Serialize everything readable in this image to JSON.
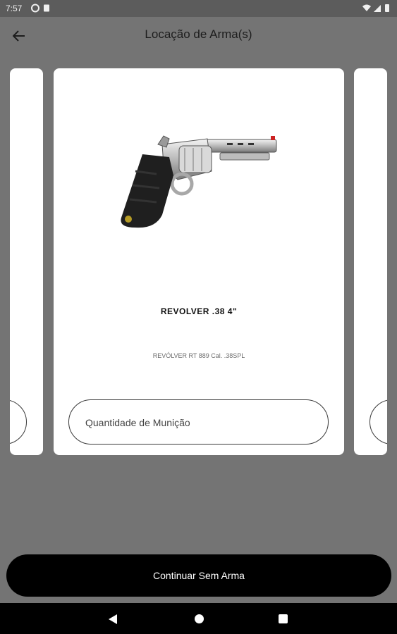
{
  "status_bar": {
    "time": "7:57",
    "left_icons": [
      "ring-icon",
      "sim-card-icon"
    ],
    "right_icons": [
      "wifi-icon",
      "signal-icon",
      "battery-icon"
    ]
  },
  "app_bar": {
    "title": "Locação de Arma(s)",
    "back_icon": "arrow-left-icon"
  },
  "carousel": {
    "current_card": {
      "name": "REVOLVER .38 4\"",
      "description": "REVÓLVER RT 889 Cal. .38SPL",
      "ammo_placeholder": "Quantidade de Munição",
      "image_icon": "revolver-image"
    }
  },
  "footer": {
    "continue_label": "Continuar Sem Arma"
  },
  "nav_bar": {
    "icons": [
      "nav-back-icon",
      "nav-home-icon",
      "nav-recents-icon"
    ]
  }
}
